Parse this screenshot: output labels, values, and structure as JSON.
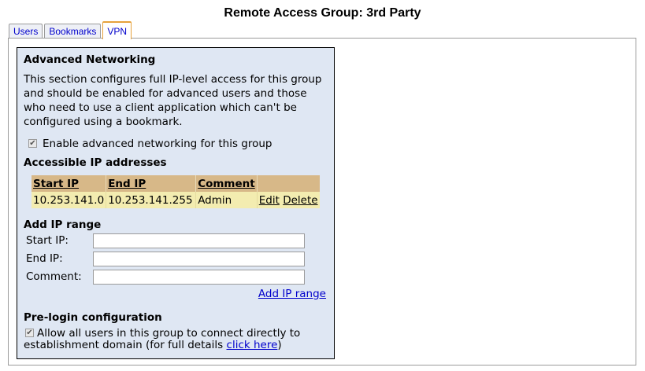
{
  "page": {
    "title": "Remote Access Group: 3rd Party"
  },
  "tabs": [
    {
      "label": "Users",
      "active": false
    },
    {
      "label": "Bookmarks",
      "active": false
    },
    {
      "label": "VPN",
      "active": true
    }
  ],
  "advanced": {
    "heading": "Advanced Networking",
    "description": "This section configures full IP-level access for this group and should be enabled for advanced users and those who need to use a client application which can't be configured using a bookmark.",
    "enable_checked": true,
    "enable_label": "Enable advanced networking for this group"
  },
  "accessible": {
    "heading": "Accessible IP addresses",
    "columns": [
      "Start IP",
      "End IP",
      "Comment"
    ],
    "rows": [
      {
        "start": "10.253.141.0",
        "end": "10.253.141.255",
        "comment": "Admin",
        "edit": "Edit",
        "delete": "Delete"
      }
    ]
  },
  "add_range": {
    "heading": "Add IP range",
    "start_label": "Start IP:",
    "end_label": "End IP:",
    "comment_label": "Comment:",
    "start_value": "",
    "end_value": "",
    "comment_value": "",
    "add_link": "Add IP range"
  },
  "prelogin": {
    "heading": "Pre-login configuration",
    "checked": true,
    "label_line1": "Allow all users in this group to connect directly to",
    "label_line2": "establishment domain (for full details ",
    "link": "click here",
    "label_end": ")"
  },
  "icons": {
    "checkbox_mark": "✔"
  }
}
